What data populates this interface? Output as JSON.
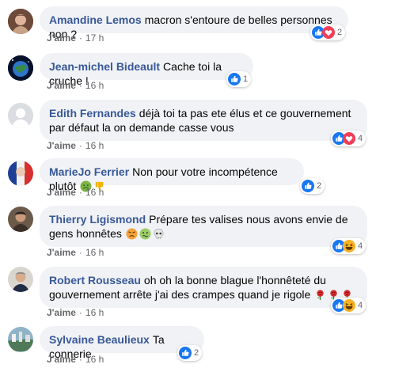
{
  "comments": [
    {
      "name": "Amandine Lemos",
      "text": "macron s'entoure de belles personnes non ?",
      "like": "J'aime",
      "time": "17 h",
      "reactions": [
        "like-icon",
        "love-icon"
      ],
      "count": "2"
    },
    {
      "name": "Jean-michel Bideault",
      "text": "Cache toi la cruche !",
      "like": "J'aime",
      "time": "16 h",
      "reactions": [
        "like-icon"
      ],
      "count": "1"
    },
    {
      "name": "Edith Fernandes",
      "text": "déjà toi ta pas ete élus et ce gouvernement par défaut la on demande casse vous",
      "like": "J'aime",
      "time": "16 h",
      "reactions": [
        "like-icon",
        "love-icon"
      ],
      "count": "4"
    },
    {
      "name": "MarieJo Ferrier",
      "text": "Non pour votre incompétence plutôt",
      "emojis": [
        "nauseated-emoji",
        "thumbs-down-emoji"
      ],
      "like": "J'aime",
      "time": "16 h",
      "reactions": [
        "like-icon"
      ],
      "count": "2"
    },
    {
      "name": "Thierry Ligismond",
      "text": "Prépare tes valises nous avons envie de gens honnêtes",
      "emojis": [
        "angry-face-emoji",
        "sick-face-emoji",
        "skull-emoji"
      ],
      "like": "J'aime",
      "time": "16 h",
      "reactions": [
        "like-icon",
        "haha-icon"
      ],
      "count": "4"
    },
    {
      "name": "Robert Rousseau",
      "text": "oh oh la bonne blague l'honnêteté du gouvernement arrête j'ai des crampes quand je rigole",
      "emojis": [
        "rose-emoji",
        "rose-emoji",
        "rose-emoji"
      ],
      "like": "J'aime",
      "time": "16 h",
      "reactions": [
        "like-icon",
        "haha-icon"
      ],
      "count": "4"
    },
    {
      "name": "Sylvaine Beaulieux",
      "text": "Ta connerie",
      "like": "J'aime",
      "time": "16 h",
      "reactions": [
        "like-icon"
      ],
      "count": "2"
    }
  ],
  "colors": {
    "name": "#385898",
    "bubble": "#f0f2f5",
    "like": "#1877f2",
    "love": "#f33e58",
    "haha": "#f7b125",
    "meta": "#65676b"
  }
}
